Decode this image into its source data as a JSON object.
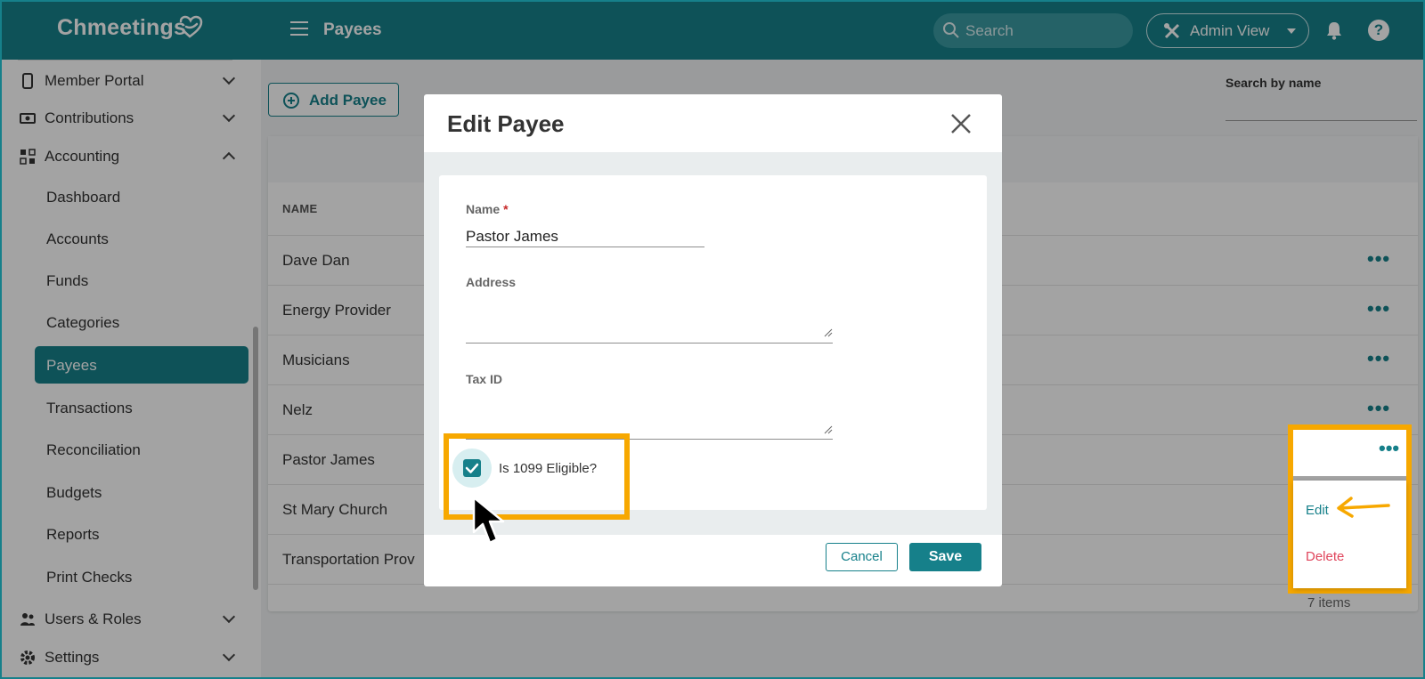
{
  "app": {
    "name": "Chmeetings",
    "page_title": "Payees"
  },
  "topbar": {
    "search_placeholder": "Search",
    "admin_view_label": "Admin View",
    "help_label": "?"
  },
  "sidebar": {
    "groups": [
      {
        "label": "Member Portal",
        "icon": "phone-icon",
        "expanded": false
      },
      {
        "label": "Contributions",
        "icon": "money-icon",
        "expanded": false
      },
      {
        "label": "Accounting",
        "icon": "grid-icon",
        "expanded": true
      }
    ],
    "sub_items": [
      "Dashboard",
      "Accounts",
      "Funds",
      "Categories",
      "Payees",
      "Transactions",
      "Reconciliation",
      "Budgets",
      "Reports",
      "Print Checks"
    ],
    "active_item": "Payees",
    "bottom_groups": [
      {
        "label": "Users & Roles",
        "icon": "users-icon"
      },
      {
        "label": "Settings",
        "icon": "gear-icon"
      }
    ]
  },
  "main": {
    "add_button_label": "Add Payee",
    "search_by_name_label": "Search by name",
    "table": {
      "column_header": "NAME",
      "rows": [
        "Dave Dan",
        "Energy Provider",
        "Musicians",
        "Nelz",
        "Pastor James",
        "St Mary Church",
        "Transportation Prov"
      ],
      "row_action": "•••",
      "items_count": "7 items"
    },
    "row_menu": {
      "edit_label": "Edit",
      "delete_label": "Delete"
    }
  },
  "modal": {
    "title": "Edit Payee",
    "name_label": "Name",
    "required_marker": "*",
    "name_value": "Pastor James",
    "address_label": "Address",
    "tax_id_label": "Tax ID",
    "checkbox_label": "Is 1099 Eligible?",
    "checkbox_checked": true,
    "cancel_label": "Cancel",
    "save_label": "Save"
  },
  "colors": {
    "brand": "#16808a",
    "highlight": "#f7a800",
    "danger": "#e0455c"
  }
}
